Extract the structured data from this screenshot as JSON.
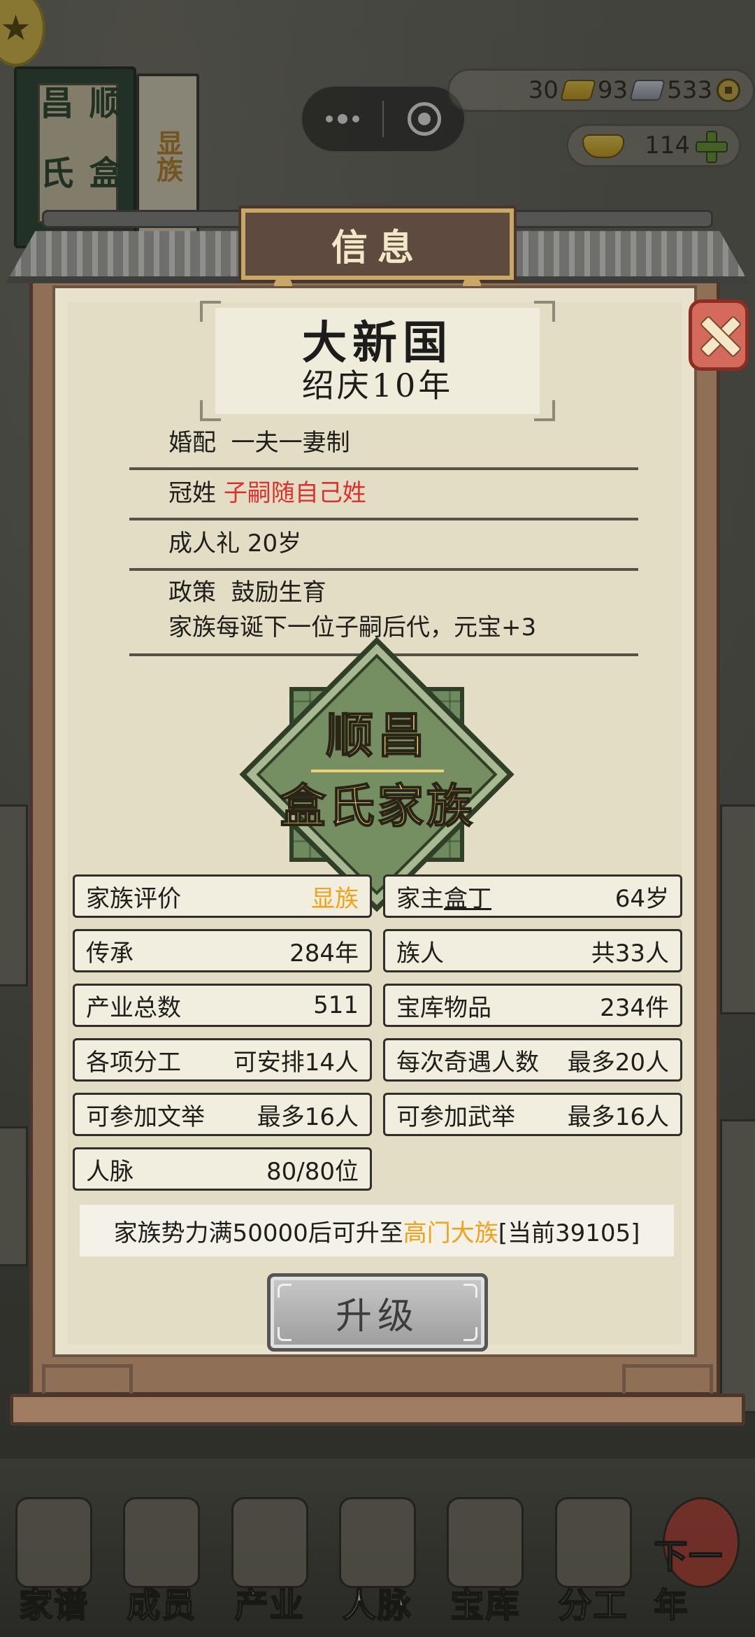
{
  "hud": {
    "gold_bars": "30",
    "silver_bars": "93",
    "coins": "533",
    "yuanbao": "114"
  },
  "background": {
    "book_title": [
      "顺昌",
      "盒氏"
    ],
    "book2_title": "显族"
  },
  "modal": {
    "title": "信息",
    "country_name": "大新国",
    "era": "绍庆10年",
    "rules": [
      {
        "label": "婚配",
        "value": "一夫一妻制"
      },
      {
        "label": "冠姓",
        "value": "子嗣随自己姓"
      },
      {
        "label": "成人礼",
        "value": "20岁"
      },
      {
        "label": "政策",
        "value": "鼓励生育",
        "detail": "家族每诞下一位子嗣后代，元宝+3"
      }
    ],
    "emblem": {
      "line1": "顺昌",
      "line2": "盒氏家族"
    },
    "stats": {
      "rating": {
        "label": "家族评价",
        "value": "显族"
      },
      "head": {
        "label": "家主",
        "name": "盒丁",
        "value": "64岁"
      },
      "heritage": {
        "label": "传承",
        "value": "284年"
      },
      "members": {
        "label": "族人",
        "value": "共33人"
      },
      "industry": {
        "label": "产业总数",
        "value": "511"
      },
      "treasury": {
        "label": "宝库物品",
        "value": "234件"
      },
      "division": {
        "label": "各项分工",
        "value": "可安排14人"
      },
      "encounter": {
        "label": "每次奇遇人数",
        "value": "最多20人"
      },
      "civil_exam": {
        "label": "可参加文举",
        "value": "最多16人"
      },
      "military_exam": {
        "label": "可参加武举",
        "value": "最多16人"
      },
      "network": {
        "label": "人脉",
        "value": "80/80位"
      }
    },
    "notice": {
      "prefix": "家族势力满50000后可升至",
      "highlight": "高门大族",
      "suffix": "[当前39105]"
    },
    "upgrade_label": "升级"
  },
  "nav": [
    {
      "label": "家谱",
      "icon": "genealogy-icon"
    },
    {
      "label": "成员",
      "icon": "member-icon"
    },
    {
      "label": "产业",
      "icon": "industry-icon"
    },
    {
      "label": "人脉",
      "icon": "network-icon"
    },
    {
      "label": "宝库",
      "icon": "treasury-icon"
    },
    {
      "label": "分工",
      "icon": "division-icon"
    },
    {
      "label": "下一年",
      "icon": "next-year-icon"
    }
  ],
  "colors": {
    "accent_red": "#e0302c",
    "accent_orange": "#f0a21a",
    "panel_brown": "#8f6f55",
    "paper": "#e4ddc6",
    "emblem_green": "#758f63"
  }
}
